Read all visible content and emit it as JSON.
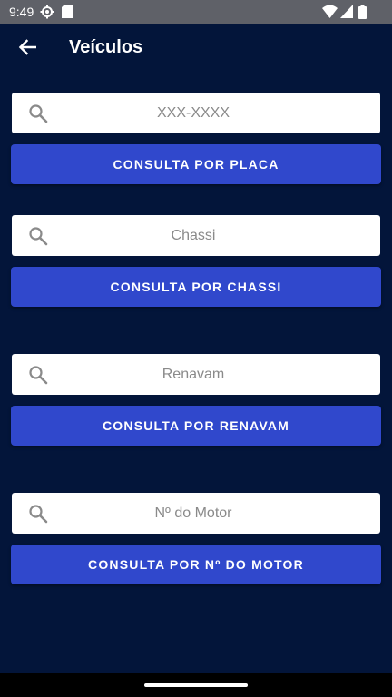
{
  "status_bar": {
    "time": "9:49",
    "left_icons": [
      "settings-gear-icon",
      "sd-card-icon"
    ],
    "right_icons": [
      "wifi-icon",
      "cellular-signal-icon",
      "battery-icon"
    ]
  },
  "app_bar": {
    "back_icon": "arrow-back-icon",
    "title": "Veículos"
  },
  "forms": {
    "placa": {
      "placeholder": "XXX-XXXX",
      "value": "",
      "button_label": "CONSULTA POR PLACA"
    },
    "chassi": {
      "placeholder": "Chassi",
      "value": "",
      "button_label": "CONSULTA POR CHASSI"
    },
    "renavam": {
      "placeholder": "Renavam",
      "value": "",
      "button_label": "CONSULTA POR RENAVAM"
    },
    "motor": {
      "placeholder": "Nº do Motor",
      "value": "",
      "button_label": "CONSULTA POR Nº DO MOTOR"
    }
  },
  "colors": {
    "background": "#03153a",
    "button": "#3048cc",
    "status_bar": "#5f6168",
    "input_background": "#ffffff",
    "icon_gray": "#8a8a8a"
  }
}
